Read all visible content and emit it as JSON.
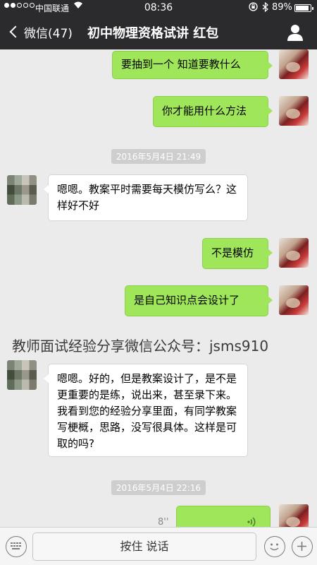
{
  "status_bar": {
    "carrier": "中国联通",
    "time": "08:36",
    "battery": "89%",
    "battery_level": 0.89,
    "signal_bars": 2
  },
  "nav": {
    "back_label": "微信(47)",
    "title": "初中物理资格试讲 红包",
    "user_icon": "user-icon"
  },
  "messages": [
    {
      "from": "me",
      "text": "要抽到一个 知道要教什么"
    },
    {
      "from": "me",
      "text": "你才能用什么方法"
    },
    {
      "type": "timestamp",
      "text": "2016年5月4日 21:49"
    },
    {
      "from": "them",
      "text": "嗯嗯。教案平时需要每天模仿写么？这样好不好"
    },
    {
      "from": "me",
      "text": "不是模仿"
    },
    {
      "from": "me",
      "text": "是自己知识点会设计了"
    },
    {
      "from": "them",
      "text": "嗯嗯。好的，但是教案设计了，是不是更重要的是练，说出来，甚至录下来。我看到您的经验分享里面，有同学教案写梗概，思路，没写很具体。这样是可取的吗?"
    },
    {
      "type": "timestamp",
      "text": "2016年5月4日 22:16"
    },
    {
      "from": "me",
      "type": "voice",
      "duration": "8''"
    }
  ],
  "watermark": "教师面试经验分享微信公众号：jsms910",
  "input_bar": {
    "hold_to_talk": "按住 说话",
    "keyboard_icon": "keyboard-icon",
    "emoji_icon": "emoji-icon",
    "plus_icon": "plus-icon"
  },
  "colors": {
    "nav_bg": "#2b2b2d",
    "my_bubble": "#9fe65b",
    "their_bubble": "#ffffff",
    "chat_bg": "#ebebeb"
  }
}
